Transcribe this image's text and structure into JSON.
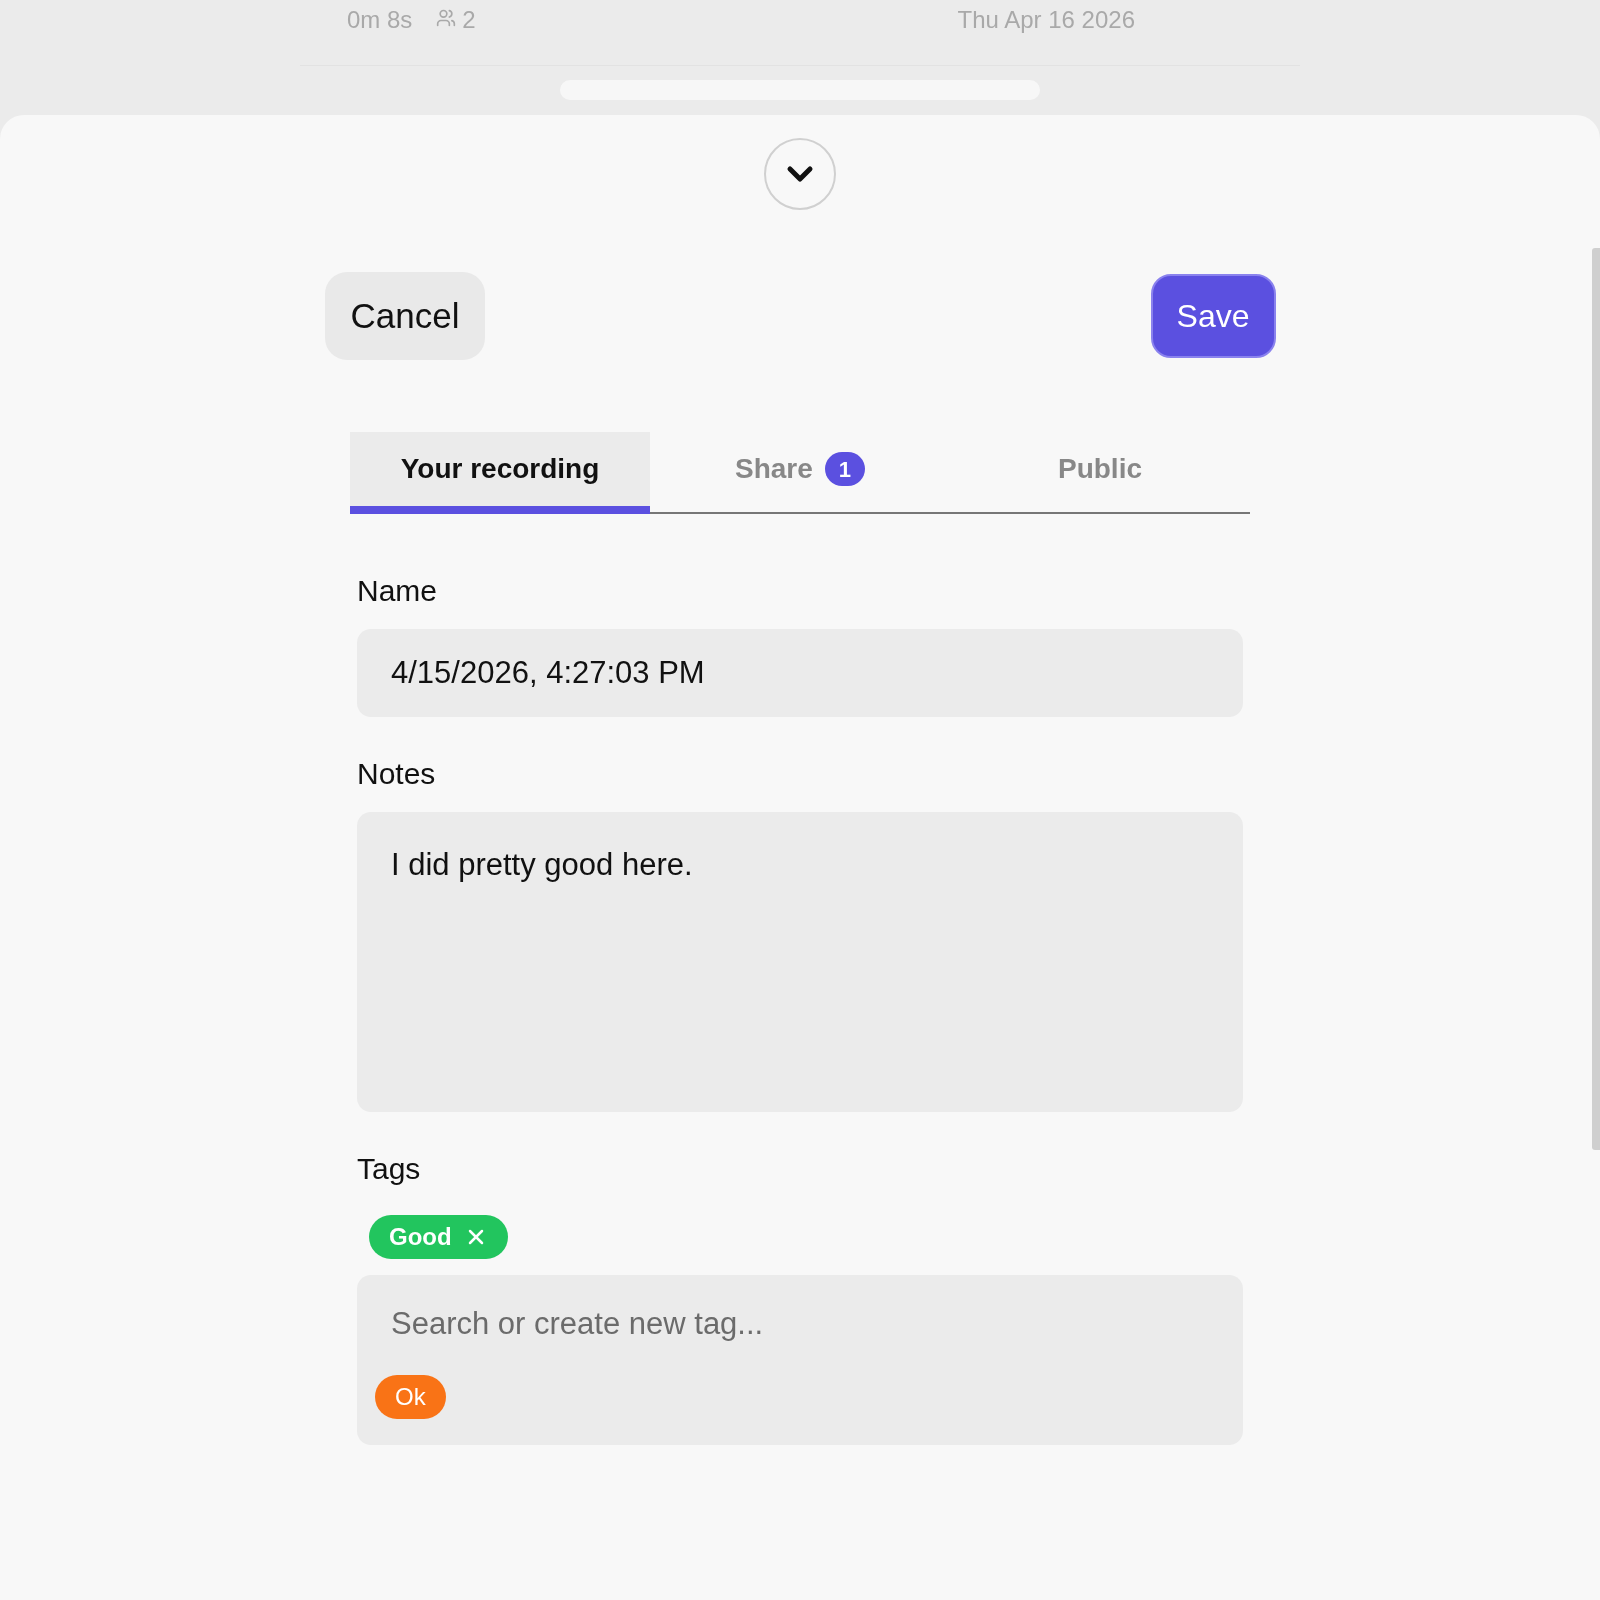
{
  "background": {
    "duration": "0m 8s",
    "participants": "2",
    "date": "Thu Apr 16 2026"
  },
  "sheet": {
    "cancel": "Cancel",
    "save": "Save"
  },
  "tabs": [
    {
      "label": "Your recording",
      "selected": true
    },
    {
      "label": "Share",
      "selected": false,
      "badge": "1"
    },
    {
      "label": "Public",
      "selected": false
    }
  ],
  "form": {
    "name_label": "Name",
    "name_value": "4/15/2026, 4:27:03 PM",
    "notes_label": "Notes",
    "notes_value": "I did pretty good here.",
    "tags_label": "Tags",
    "tags": [
      {
        "label": "Good",
        "color": "#22c55e"
      }
    ],
    "tag_search": {
      "placeholder": "Search or create new tag..."
    },
    "suggestions": [
      {
        "label": "Ok",
        "color": "#f97316"
      }
    ]
  }
}
